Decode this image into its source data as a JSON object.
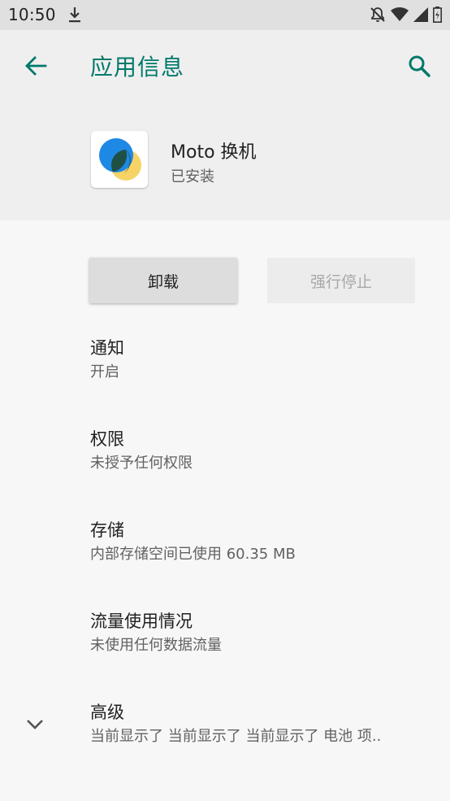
{
  "status_bar": {
    "time": "10:50",
    "icons": [
      "download-icon",
      "notifications-off-icon",
      "wifi-icon",
      "cell-signal-icon",
      "battery-icon"
    ]
  },
  "app_bar": {
    "title": "应用信息",
    "back_icon": "arrow-back-icon",
    "search_icon": "search-icon",
    "accent_color": "#00796b"
  },
  "app_header": {
    "name": "Moto 换机",
    "status": "已安装",
    "icon": "moto-migrate-app-icon"
  },
  "actions": {
    "uninstall_label": "卸载",
    "force_stop_label": "强行停止"
  },
  "preferences": [
    {
      "title": "通知",
      "summary": "开启"
    },
    {
      "title": "权限",
      "summary": "未授予任何权限"
    },
    {
      "title": "存储",
      "summary": "内部存储空间已使用 60.35 MB"
    },
    {
      "title": "流量使用情况",
      "summary": "未使用任何数据流量"
    },
    {
      "title": "高级",
      "summary": "当前显示了 当前显示了 当前显示了 电池 项.."
    }
  ]
}
